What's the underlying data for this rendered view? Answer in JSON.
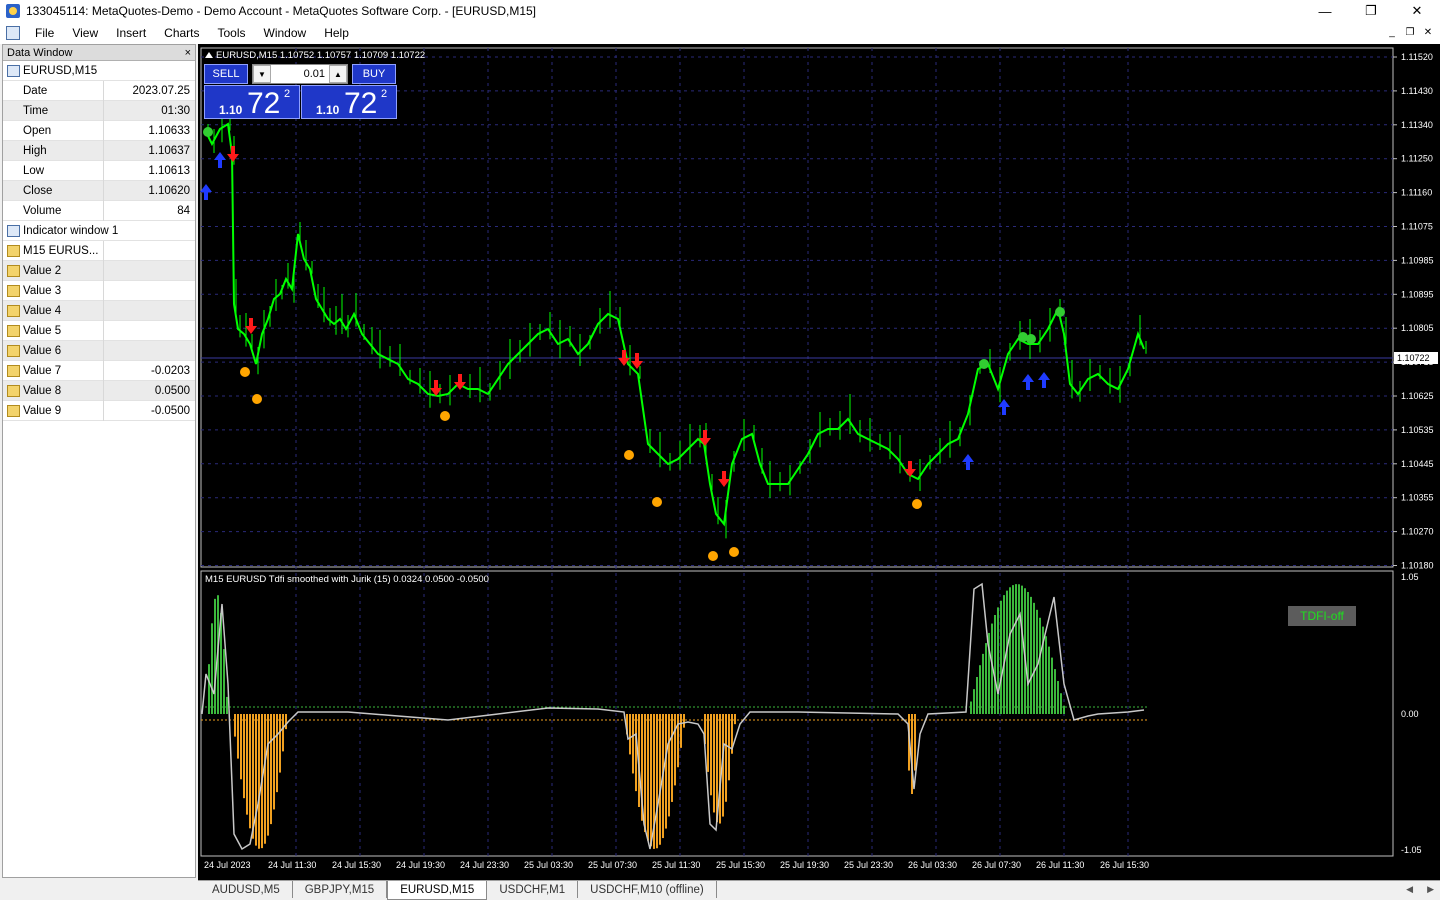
{
  "window": {
    "title": "133045114: MetaQuotes-Demo - Demo Account - MetaQuotes Software Corp. - [EURUSD,M15]",
    "minimize": "—",
    "maximize": "❐",
    "close": "✕"
  },
  "menu": [
    "File",
    "View",
    "Insert",
    "Charts",
    "Tools",
    "Window",
    "Help"
  ],
  "mdi": {
    "minimize": "_",
    "restore": "❐",
    "close": "✕"
  },
  "data_window": {
    "title": "Data Window",
    "close": "×",
    "symbol": "EURUSD,M15",
    "rows": [
      {
        "label": "Date",
        "value": "2023.07.25"
      },
      {
        "label": "Time",
        "value": "01:30"
      },
      {
        "label": "Open",
        "value": "1.10633"
      },
      {
        "label": "High",
        "value": "1.10637"
      },
      {
        "label": "Low",
        "value": "1.10613"
      },
      {
        "label": "Close",
        "value": "1.10620"
      },
      {
        "label": "Volume",
        "value": "84"
      }
    ],
    "indicator_window": "Indicator window 1",
    "indicator_rows": [
      {
        "label": "M15 EURUS...",
        "value": ""
      },
      {
        "label": "Value 2",
        "value": ""
      },
      {
        "label": "Value 3",
        "value": ""
      },
      {
        "label": "Value 4",
        "value": ""
      },
      {
        "label": "Value 5",
        "value": ""
      },
      {
        "label": "Value 6",
        "value": ""
      },
      {
        "label": "Value 7",
        "value": "-0.0203"
      },
      {
        "label": "Value 8",
        "value": "0.0500"
      },
      {
        "label": "Value 9",
        "value": "-0.0500"
      }
    ]
  },
  "chart": {
    "header": "EURUSD,M15  1.10752 1.10757 1.10709 1.10722",
    "indicator_header": "M15 EURUSD Tdfi smoothed with Jurik (15) 0.0324 0.0500 -0.0500",
    "current_price": "1.10722",
    "price_ticks": [
      "1.11520",
      "1.11430",
      "1.11340",
      "1.11250",
      "1.11160",
      "1.11075",
      "1.10985",
      "1.10895",
      "1.10805",
      "1.10715",
      "1.10625",
      "1.10535",
      "1.10445",
      "1.10355",
      "1.10270",
      "1.10180"
    ],
    "indicator_ticks": [
      "1.05",
      "0.00",
      "-1.05"
    ],
    "time_ticks": [
      "24 Jul 2023",
      "24 Jul 11:30",
      "24 Jul 15:30",
      "24 Jul 19:30",
      "24 Jul 23:30",
      "25 Jul 03:30",
      "25 Jul 07:30",
      "25 Jul 11:30",
      "25 Jul 15:30",
      "25 Jul 19:30",
      "25 Jul 23:30",
      "26 Jul 03:30",
      "26 Jul 07:30",
      "26 Jul 11:30",
      "26 Jul 15:30"
    ],
    "tdfi_badge": "TDFI-off",
    "colors": {
      "bull": "#00ff00",
      "dot_green": "#32cd32",
      "dot_orange": "#ffa500",
      "arrow_up": "#1f3bff",
      "arrow_down": "#ff1a1a",
      "hist_up": "#3cb83c",
      "hist_down": "#f0a020",
      "line": "#c8c8c8",
      "grid": "#2a2a7a"
    }
  },
  "trade": {
    "sell": "SELL",
    "buy": "BUY",
    "lot": "0.01",
    "bid_small": "1.10",
    "bid_big": "72",
    "bid_sup": "2",
    "ask_small": "1.10",
    "ask_big": "72",
    "ask_sup": "2"
  },
  "tabs": [
    {
      "label": "AUDUSD,M5",
      "active": false
    },
    {
      "label": "GBPJPY,M15",
      "active": false
    },
    {
      "label": "EURUSD,M15",
      "active": true
    },
    {
      "label": "USDCHF,M1",
      "active": false
    },
    {
      "label": "USDCHF,M10 (offline)",
      "active": false
    }
  ],
  "tab_arrows": {
    "left": "◀",
    "right": "▶"
  }
}
